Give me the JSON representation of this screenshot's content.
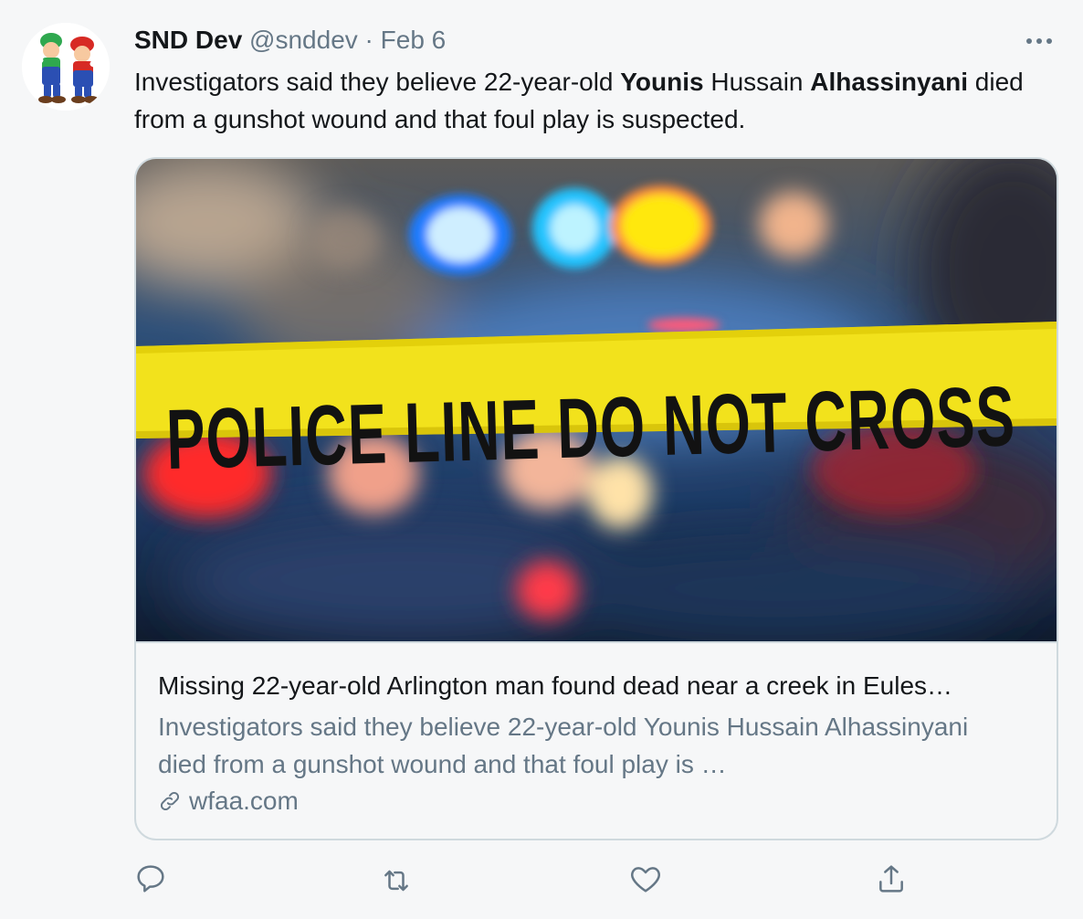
{
  "tweet": {
    "author_name": "SND Dev",
    "author_handle": "@snddev",
    "separator": "·",
    "date": "Feb 6",
    "text_part1": "Investigators said they believe 22-year-old ",
    "text_bold1": "Younis",
    "text_part2": " Hussain ",
    "text_bold2": "Alhassinyani",
    "text_part3": " died from a gunshot wound and that foul play is suspected."
  },
  "card": {
    "image_caption": "POLICE LINE DO NOT CROSS",
    "title": "Missing 22-year-old Arlington man found dead near a creek in Eules…",
    "description": "Investigators said they believe 22-year-old Younis Hussain Alhassinyani died from a gunshot wound and that foul play is …",
    "domain": "wfaa.com"
  },
  "icons": {
    "avatar": "cartoon-characters-avatar",
    "more": "more-horizontal-icon",
    "link": "link-icon",
    "reply": "reply-icon",
    "retweet": "retweet-icon",
    "like": "heart-icon",
    "share": "share-icon"
  },
  "colors": {
    "background": "#f6f7f8",
    "text_primary": "#14171a",
    "text_secondary": "#657786",
    "border": "#cfd9de",
    "tape_yellow": "#f2e21c"
  }
}
